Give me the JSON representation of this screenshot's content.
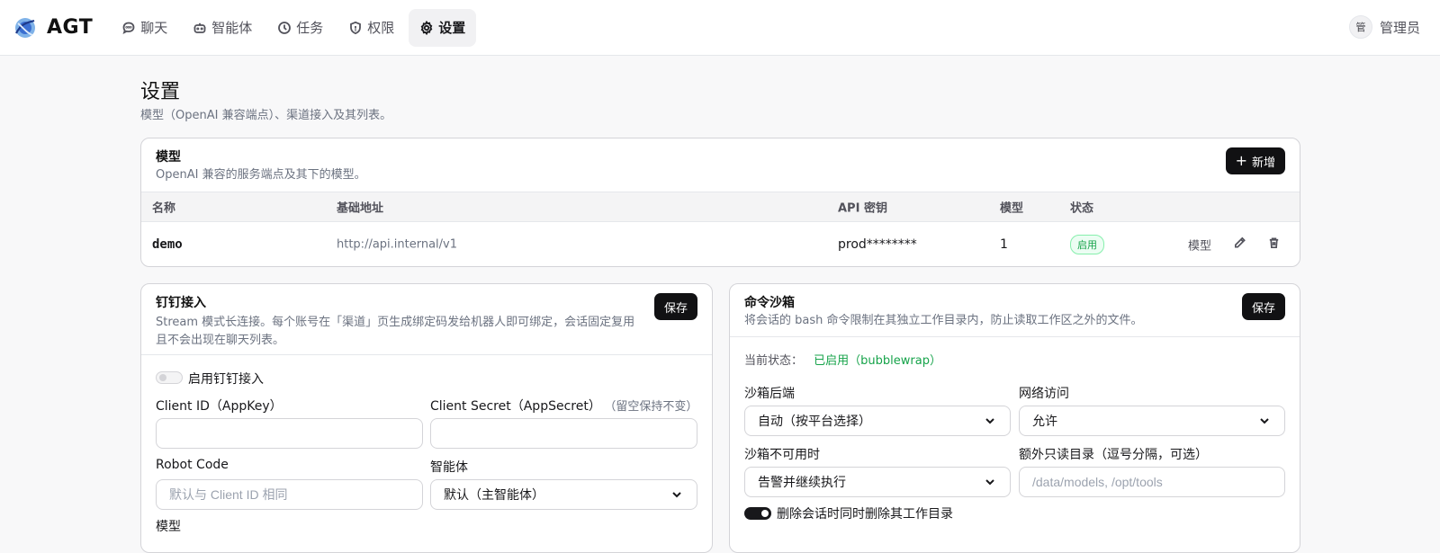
{
  "app": {
    "brand": "AGT"
  },
  "nav": [
    {
      "label": "聊天",
      "icon": "chat-icon",
      "active": false
    },
    {
      "label": "智能体",
      "icon": "robot-icon",
      "active": false
    },
    {
      "label": "任务",
      "icon": "clock-icon",
      "active": false
    },
    {
      "label": "权限",
      "icon": "shield-icon",
      "active": false
    },
    {
      "label": "设置",
      "icon": "gear-icon",
      "active": true
    }
  ],
  "user": {
    "avatar_text": "管",
    "name": "管理员"
  },
  "page": {
    "title": "设置",
    "subtitle": "模型（OpenAI 兼容端点）、渠道接入及其列表。"
  },
  "models": {
    "title": "模型",
    "desc": "OpenAI 兼容的服务端点及其下的模型。",
    "add_label": "新增",
    "columns": [
      "名称",
      "基础地址",
      "API 密钥",
      "模型",
      "状态"
    ],
    "rows": [
      {
        "name": "demo",
        "base_url": "http://api.internal/v1",
        "api_key": "prod********",
        "model_count": "1",
        "status": "启用",
        "action_models": "模型"
      }
    ]
  },
  "dingtalk": {
    "title": "钉钉接入",
    "desc": "Stream 模式长连接。每个账号在「渠道」页生成绑定码发给机器人即可绑定，会话固定复用且不会出现在聊天列表。",
    "save_label": "保存",
    "enable_label": "启用钉钉接入",
    "client_id_label": "Client ID（AppKey）",
    "client_id_value": "",
    "client_secret_label": "Client Secret（AppSecret）",
    "client_secret_hint": "（留空保持不变）",
    "client_secret_value": "",
    "robot_code_label": "Robot Code",
    "robot_code_placeholder": "默认与 Client ID 相同",
    "agent_label": "智能体",
    "agent_value": "默认（主智能体）",
    "model_label": "模型"
  },
  "sandbox": {
    "title": "命令沙箱",
    "desc": "将会话的 bash 命令限制在其独立工作目录内，防止读取工作区之外的文件。",
    "save_label": "保存",
    "status_label": "当前状态：",
    "status_value": "已启用（bubblewrap）",
    "backend_label": "沙箱后端",
    "backend_value": "自动（按平台选择）",
    "network_label": "网络访问",
    "network_value": "允许",
    "unavailable_label": "沙箱不可用时",
    "unavailable_value": "告警并继续执行",
    "extra_ro_label": "额外只读目录（逗号分隔，可选）",
    "extra_ro_placeholder": "/data/models, /opt/tools",
    "delete_workdir_label": "删除会话时同时删除其工作目录"
  },
  "colors": {
    "accent_green": "#16a34a",
    "dark_button": "#111113"
  }
}
